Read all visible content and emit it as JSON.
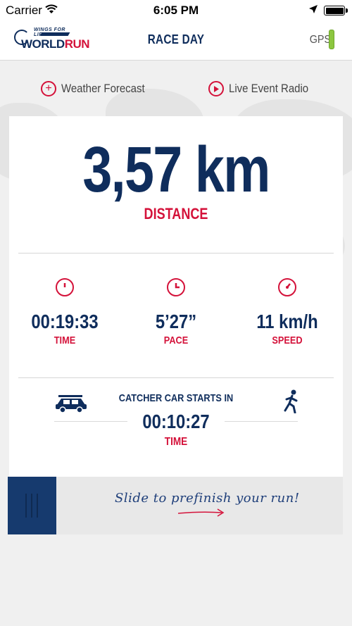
{
  "status_bar": {
    "carrier": "Carrier",
    "time": "6:05 PM"
  },
  "nav": {
    "logo_small": "WINGS FOR LIFE",
    "logo_main_a": "WORLD",
    "logo_main_b": "RUN",
    "title": "RACE DAY",
    "gps_label": "GPS"
  },
  "actions": {
    "weather_label": "Weather Forecast",
    "radio_label": "Live Event Radio"
  },
  "distance": {
    "value": "3,57 km",
    "label": "DISTANCE"
  },
  "stats": [
    {
      "icon": "stopwatch-icon",
      "value": "00:19:33",
      "label": "TIME"
    },
    {
      "icon": "pace-clock-icon",
      "value": "5’27”",
      "label": "PACE"
    },
    {
      "icon": "speedometer-icon",
      "value": "11 km/h",
      "label": "SPEED"
    }
  ],
  "catcher": {
    "title": "CATCHER CAR STARTS IN",
    "time": "00:10:27",
    "label": "TIME"
  },
  "slider": {
    "text": "Slide to prefinish your run!"
  },
  "colors": {
    "navy": "#0f2d5c",
    "red": "#d4123a",
    "gps_green": "#8cc63f",
    "handle_blue": "#163a6e"
  }
}
